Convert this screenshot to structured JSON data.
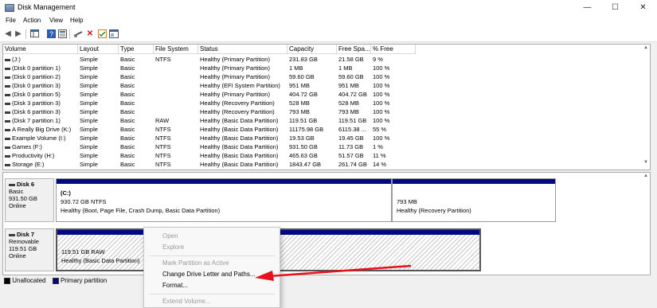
{
  "window": {
    "title": "Disk Management",
    "minimize_icon": "—",
    "maximize_icon": "☐",
    "close_icon": "✕"
  },
  "menu": [
    "File",
    "Action",
    "View",
    "Help"
  ],
  "toolbar_icons": [
    "back-arrow",
    "forward-arrow",
    "console-tree",
    "help",
    "properties",
    "connect",
    "delete",
    "check",
    "settings"
  ],
  "volumes": {
    "columns": [
      "Volume",
      "Layout",
      "Type",
      "File System",
      "Status",
      "Capacity",
      "Free Spa...",
      "% Free"
    ],
    "rows": [
      [
        "(J:)",
        "Simple",
        "Basic",
        "NTFS",
        "Healthy (Primary Partition)",
        "231.83 GB",
        "21.58 GB",
        "9 %"
      ],
      [
        "(Disk 0 partition 1)",
        "Simple",
        "Basic",
        "",
        "Healthy (Primary Partition)",
        "1 MB",
        "1 MB",
        "100 %"
      ],
      [
        "(Disk 0 partition 2)",
        "Simple",
        "Basic",
        "",
        "Healthy (Primary Partition)",
        "59.60 GB",
        "59.60 GB",
        "100 %"
      ],
      [
        "(Disk 0 partition 3)",
        "Simple",
        "Basic",
        "",
        "Healthy (EFI System Partition)",
        "951 MB",
        "951 MB",
        "100 %"
      ],
      [
        "(Disk 0 partition 5)",
        "Simple",
        "Basic",
        "",
        "Healthy (Primary Partition)",
        "404.72 GB",
        "404.72 GB",
        "100 %"
      ],
      [
        "(Disk 3 partition 3)",
        "Simple",
        "Basic",
        "",
        "Healthy (Recovery Partition)",
        "528 MB",
        "528 MB",
        "100 %"
      ],
      [
        "(Disk 6 partition 3)",
        "Simple",
        "Basic",
        "",
        "Healthy (Recovery Partition)",
        "793 MB",
        "793 MB",
        "100 %"
      ],
      [
        "(Disk 7 partition 1)",
        "Simple",
        "Basic",
        "RAW",
        "Healthy (Basic Data Partition)",
        "119.51 GB",
        "119.51 GB",
        "100 %"
      ],
      [
        "A Really Big Drive (K:)",
        "Simple",
        "Basic",
        "NTFS",
        "Healthy (Basic Data Partition)",
        "11175.98 GB",
        "6115.38 ...",
        "55 %"
      ],
      [
        "Example Volume (I:)",
        "Simple",
        "Basic",
        "NTFS",
        "Healthy (Basic Data Partition)",
        "19.53 GB",
        "19.45 GB",
        "100 %"
      ],
      [
        "Games (F:)",
        "Simple",
        "Basic",
        "NTFS",
        "Healthy (Basic Data Partition)",
        "931.50 GB",
        "11.73 GB",
        "1 %"
      ],
      [
        "Productivity (H:)",
        "Simple",
        "Basic",
        "NTFS",
        "Healthy (Basic Data Partition)",
        "465.63 GB",
        "51.57 GB",
        "11 %"
      ],
      [
        "Storage (E:)",
        "Simple",
        "Basic",
        "NTFS",
        "Healthy (Basic Data Partition)",
        "1843.47 GB",
        "261.74 GB",
        "14 %"
      ]
    ]
  },
  "disks": {
    "disk6": {
      "name": "Disk 6",
      "type": "Basic",
      "size": "931.50 GB",
      "status": "Online",
      "p1": {
        "name": "(C:)",
        "size": "930.72 GB NTFS",
        "status": "Healthy (Boot, Page File, Crash Dump, Basic Data Partition)"
      },
      "p2": {
        "size": "793 MB",
        "status": "Healthy (Recovery Partition)"
      }
    },
    "disk7": {
      "name": "Disk 7",
      "type": "Removable",
      "size": "119.51 GB",
      "status": "Online",
      "p1": {
        "size": "119.51 GB RAW",
        "status": "Healthy (Basic Data Partition)"
      }
    }
  },
  "legend": {
    "unallocated": "Unallocated",
    "primary": "Primary partition",
    "unallocated_color": "#000000",
    "primary_color": "#000a80"
  },
  "context_menu": {
    "open": "Open",
    "explore": "Explore",
    "mark_active": "Mark Partition as Active",
    "change_letter": "Change Drive Letter and Paths...",
    "format": "Format...",
    "extend": "Extend Volume..."
  },
  "colors": {
    "arrow": "#e8101a",
    "partition_bar": "#000a80"
  }
}
